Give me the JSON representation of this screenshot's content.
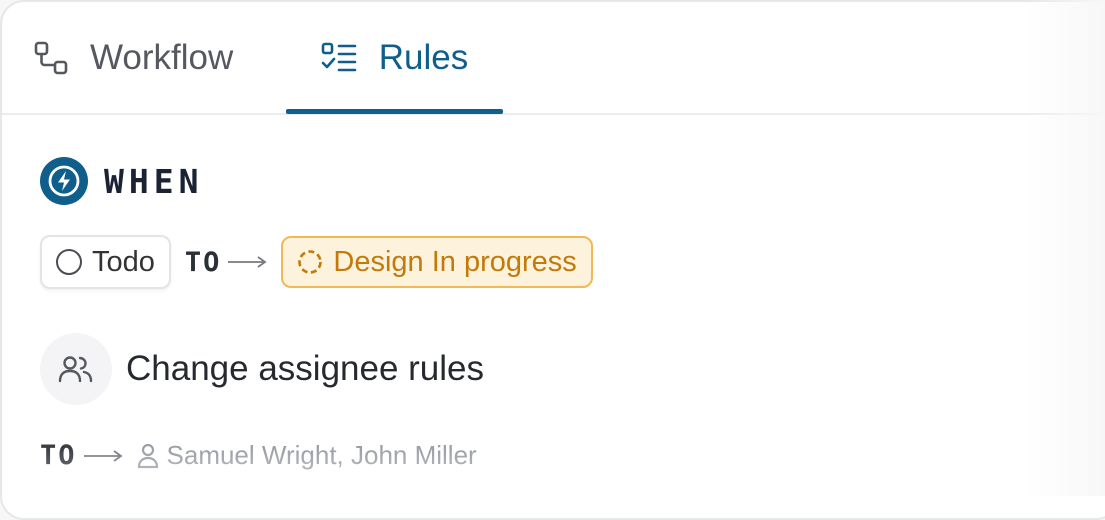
{
  "tabs": [
    {
      "label": "Workflow",
      "icon": "workflow-icon",
      "active": false
    },
    {
      "label": "Rules",
      "icon": "rules-checklist-icon",
      "active": true
    }
  ],
  "trigger": {
    "label": "WHEN",
    "icon": "lightning-bolt-icon",
    "from_status": {
      "label": "Todo",
      "icon": "circle-outline-icon"
    },
    "to_label": "TO",
    "to_status": {
      "label": "Design In progress",
      "icon": "dashed-circle-icon",
      "color": "#c27a0a"
    }
  },
  "rule": {
    "title": "Change assignee rules",
    "icon": "users-icon",
    "to_label": "TO",
    "assignees": "Samuel Wright, John Miller",
    "assignee_icon": "user-icon"
  },
  "colors": {
    "accent": "#0f5e8c",
    "progress_bg": "#fdf2dc",
    "progress_border": "#f0b955"
  }
}
